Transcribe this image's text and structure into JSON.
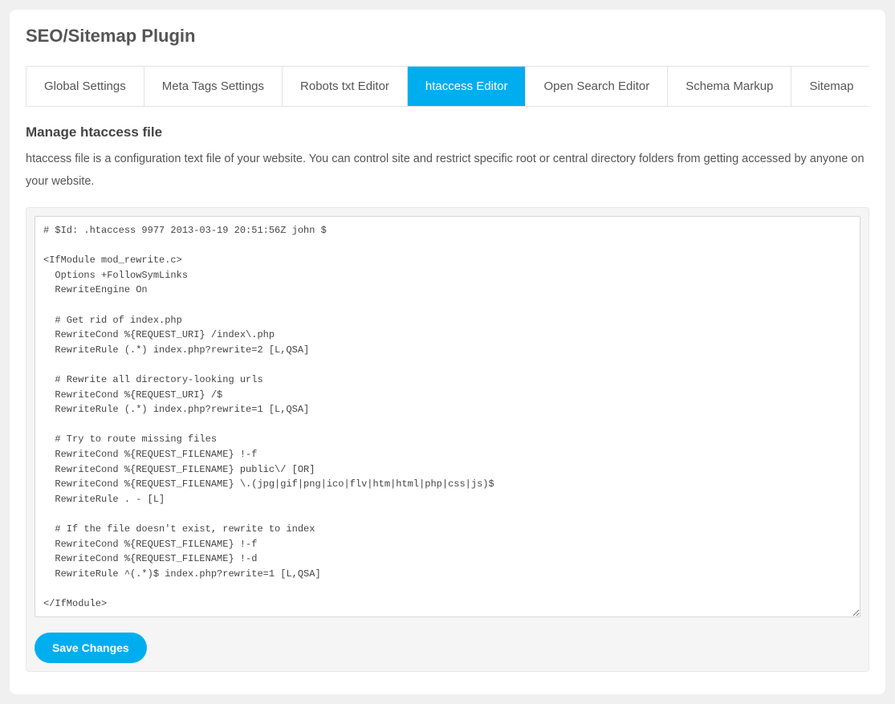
{
  "page_title": "SEO/Sitemap Plugin",
  "tabs": [
    {
      "label": "Global Settings",
      "active": false
    },
    {
      "label": "Meta Tags Settings",
      "active": false
    },
    {
      "label": "Robots txt Editor",
      "active": false
    },
    {
      "label": "htaccess Editor",
      "active": true
    },
    {
      "label": "Open Search Editor",
      "active": false
    },
    {
      "label": "Schema Markup",
      "active": false
    },
    {
      "label": "Sitemap",
      "active": false
    }
  ],
  "section": {
    "title": "Manage htaccess file",
    "description": "htaccess file is a configuration text file of your website. You can control site and restrict specific root or central directory folders from getting accessed by anyone on your website."
  },
  "editor": {
    "value": "# $Id: .htaccess 9977 2013-03-19 20:51:56Z john $\n\n<IfModule mod_rewrite.c>\n  Options +FollowSymLinks\n  RewriteEngine On\n\n  # Get rid of index.php\n  RewriteCond %{REQUEST_URI} /index\\.php\n  RewriteRule (.*) index.php?rewrite=2 [L,QSA]\n\n  # Rewrite all directory-looking urls\n  RewriteCond %{REQUEST_URI} /$\n  RewriteRule (.*) index.php?rewrite=1 [L,QSA]\n\n  # Try to route missing files\n  RewriteCond %{REQUEST_FILENAME} !-f\n  RewriteCond %{REQUEST_FILENAME} public\\/ [OR]\n  RewriteCond %{REQUEST_FILENAME} \\.(jpg|gif|png|ico|flv|htm|html|php|css|js)$\n  RewriteRule . - [L]\n\n  # If the file doesn't exist, rewrite to index\n  RewriteCond %{REQUEST_FILENAME} !-f\n  RewriteCond %{REQUEST_FILENAME} !-d\n  RewriteRule ^(.*)$ index.php?rewrite=1 [L,QSA]\n\n</IfModule>\n\n# sends requests /index.php/path/to/module/ to \"index.php\"\n# AcceptPathInfo On\n\n# @todo This may not be effective in some cases\nFileETag Size\n\n<IfModule mod_deflate.c>\n  AddOutputFilterByType DEFLATE text/text text/html text/plain text/xml text/css application/x-javascript application/javascript\n</IfModule>"
  },
  "buttons": {
    "save": "Save Changes"
  },
  "colors": {
    "accent": "#00aeef"
  }
}
